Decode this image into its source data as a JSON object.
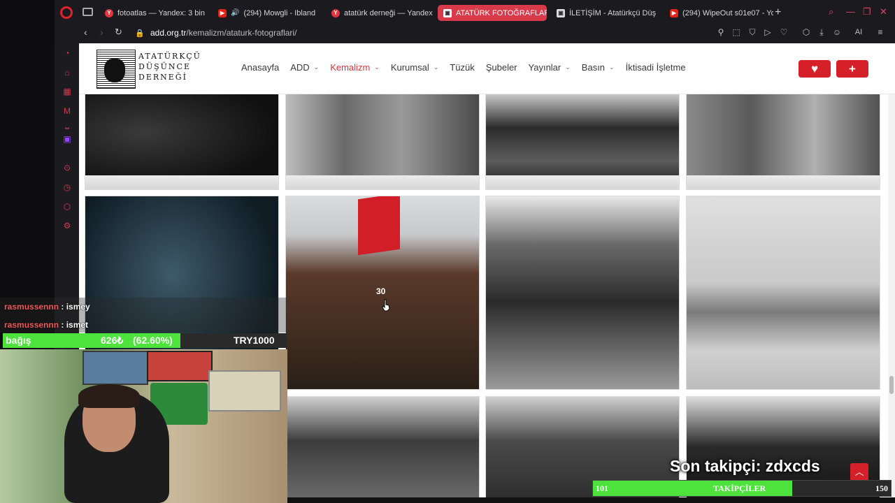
{
  "browser": {
    "tabs": [
      {
        "label": "fotoatlas — Yandex: 3 bin",
        "favicon": "yandex-icon",
        "active": false
      },
      {
        "label": "(294) Mowgli - Ibland",
        "favicon": "youtube-icon",
        "active": false
      },
      {
        "label": "atatürk derneği — Yandex",
        "favicon": "yandex-icon",
        "active": false
      },
      {
        "label": "ATATÜRK FOTOĞRAFLARI",
        "favicon": "add-site-icon",
        "active": true
      },
      {
        "label": "İLETİŞİM - Atatürkçü Düş",
        "favicon": "add-site-icon",
        "active": false
      },
      {
        "label": "(294) WipeOut s01e07 - Yo",
        "favicon": "youtube-icon",
        "active": false
      }
    ],
    "url_domain": "add.org.tr",
    "url_path": "/kemalizm/ataturk-fotograflari/",
    "toolbar_ai_label": "AI",
    "accent_color": "#d93a4a"
  },
  "site": {
    "logo_text": [
      "ATATÜRKÇÜ",
      "DÜŞÜNCE",
      "DERNEĞİ"
    ],
    "menu": [
      {
        "label": "Anasayfa",
        "dropdown": false,
        "active": false
      },
      {
        "label": "ADD",
        "dropdown": true,
        "active": false
      },
      {
        "label": "Kemalizm",
        "dropdown": true,
        "active": true
      },
      {
        "label": "Kurumsal",
        "dropdown": true,
        "active": false
      },
      {
        "label": "Tüzük",
        "dropdown": false,
        "active": false
      },
      {
        "label": "Şubeler",
        "dropdown": false,
        "active": false
      },
      {
        "label": "Yayınlar",
        "dropdown": true,
        "active": false
      },
      {
        "label": "Basın",
        "dropdown": true,
        "active": false
      },
      {
        "label": "İktisadi İşletme",
        "dropdown": false,
        "active": false
      }
    ],
    "heart_button_icon": "heart-icon",
    "plus_button_icon": "plus-icon",
    "brand_red": "#d5202a",
    "photo_counter": "30"
  },
  "stream": {
    "chat": [
      {
        "user": "rasmussennn",
        "message": "ismey"
      },
      {
        "user": "rasmussennn",
        "message": "ismet"
      }
    ],
    "donation": {
      "label": "bağış",
      "amount": "626₺",
      "percent_text": "(62.60%)",
      "fraction": 0.626,
      "goal": "TRY1000"
    },
    "last_follower": "Son takipçi: zdxcds",
    "followers_bar": {
      "start": "101",
      "label": "TAKİPÇİLER",
      "end": "150",
      "fraction": 0.67
    },
    "bar_color": "#4ee23c"
  }
}
